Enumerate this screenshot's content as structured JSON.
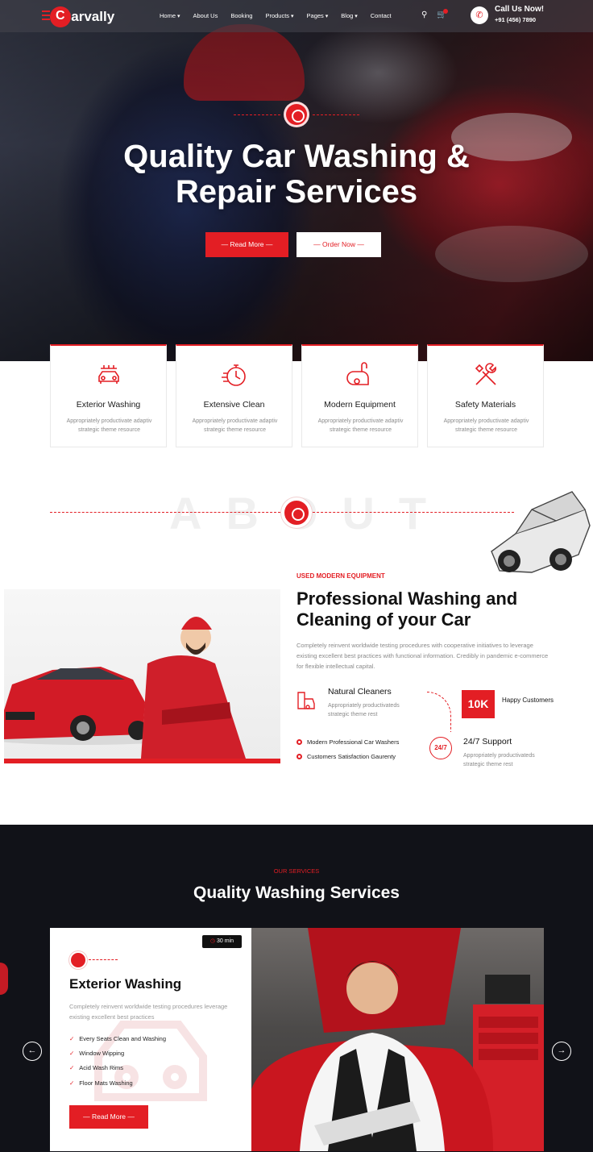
{
  "brand": {
    "name": "Carvally",
    "accent": "#e31e24"
  },
  "nav": {
    "items": [
      {
        "label": "Home",
        "dropdown": true
      },
      {
        "label": "About Us",
        "dropdown": false
      },
      {
        "label": "Booking",
        "dropdown": false
      },
      {
        "label": "Products",
        "dropdown": true
      },
      {
        "label": "Pages",
        "dropdown": true
      },
      {
        "label": "Blog",
        "dropdown": true
      },
      {
        "label": "Contact",
        "dropdown": false
      }
    ],
    "icons": [
      "search-icon",
      "cart-icon"
    ],
    "call": {
      "title": "Call Us Now!",
      "phone": "+91 (456) 7890",
      "icon": "phone-icon"
    }
  },
  "hero": {
    "title_line1": "Quality Car Washing &",
    "title_line2": "Repair Services",
    "primary_button": "Read More",
    "secondary_button": "Order Now"
  },
  "features": [
    {
      "icon": "car-wash-icon",
      "title": "Exterior Washing",
      "desc_line1": "Appropriately productivate adaptiv",
      "desc_line2": "strategic theme resource"
    },
    {
      "icon": "stopwatch-icon",
      "title": "Extensive Clean",
      "desc_line1": "Appropriately productivate adaptiv",
      "desc_line2": "strategic theme resource"
    },
    {
      "icon": "vacuum-icon",
      "title": "Modern Equipment",
      "desc_line1": "Appropriately productivate adaptiv",
      "desc_line2": "strategic theme resource"
    },
    {
      "icon": "tools-icon",
      "title": "Safety Materials",
      "desc_line1": "Appropriately productivate adaptiv",
      "desc_line2": "strategic theme resource"
    }
  ],
  "about": {
    "watermark": "ABOUT",
    "eyebrow": "USED MODERN EQUIPMENT",
    "title_line1": "Professional Washing and",
    "title_line2": "Cleaning of your Car",
    "desc_line1": "Completely reinvent worldwide testing procedures with cooperative initiatives to leverage",
    "desc_line2": "existing excellent best practices with functional information. Credibly in pandemic e-commerce",
    "desc_line3": "for flexible intellectual capital.",
    "feature": {
      "icon": "cleaner-icon",
      "title": "Natural Cleaners",
      "desc_line1": "Appropriately productivateds",
      "desc_line2": "strategic theme rest"
    },
    "stat": {
      "value": "10K",
      "label": "Happy Customers"
    },
    "checks": [
      "Modern Professional Car Washers",
      "Customers Satisfaction Gaurenty"
    ],
    "support": {
      "icon_text": "24/7",
      "title": "24/7 Support",
      "desc_line1": "Appropriately productivateds",
      "desc_line2": "strategic theme rest"
    }
  },
  "services": {
    "eyebrow": "OUR SERVICES",
    "title": "Quality Washing Services",
    "card": {
      "time": "30 min",
      "title": "Exterior Washing",
      "desc_line1": "Completely reinvent worldwide testing procedures leverage",
      "desc_line2": "existing excellent best practices",
      "items": [
        "Every Seats Clean and Washing",
        "Window Wipping",
        "Acid Wash Rims",
        "Floor Mats Washing"
      ],
      "button": "Read More"
    },
    "prev_arrow": "←",
    "next_arrow": "→"
  }
}
